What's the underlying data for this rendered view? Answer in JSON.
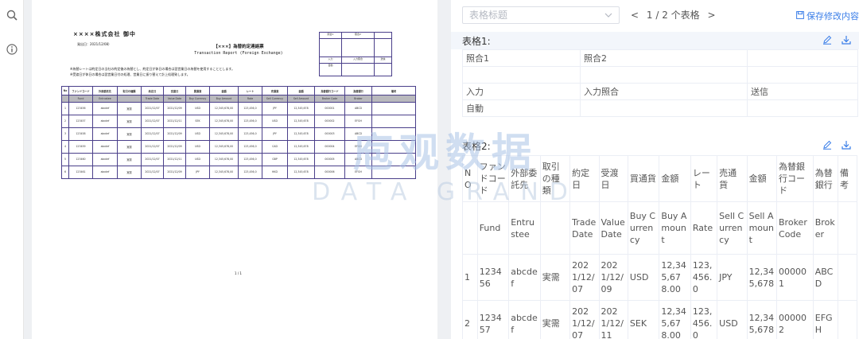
{
  "rail": {
    "icons": [
      "search-icon",
      "info-icon"
    ]
  },
  "document": {
    "recipient": "××××株式会社 御中",
    "issued": "発出日：2021/12/08）",
    "title": "【×××】為替約定連絡票",
    "subtitle": "Transaction Report (Foreign Exchange)",
    "notes": [
      "※為替レートは約定日の当社の約定後の為替とし、約定日が休日の場合は翌営業日の為替を使用することとします。",
      "※受渡日が休日の場合は翌営業日付の処理、営業日に振り替えて計上処理致します。"
    ],
    "stamp": {
      "row1": [
        "照合1",
        "照合2",
        ""
      ],
      "row2": [
        "",
        "",
        ""
      ],
      "row3": [
        "入力",
        "入力照合",
        "送信"
      ],
      "row4": [
        "自動",
        "",
        ""
      ]
    },
    "table": {
      "head1": [
        "No",
        "ファンドコード",
        "外部委託先",
        "取引の種類",
        "約定日",
        "受渡日",
        "買通貨",
        "金額",
        "レート",
        "売通貨",
        "金額",
        "為替銀行コード",
        "為替銀行",
        "備考"
      ],
      "head2": [
        "",
        "Fund",
        "Entrustee",
        "",
        "Trade Date",
        "Value Date",
        "Buy Currency",
        "Buy Amount",
        "Rate",
        "Sell Currency",
        "Sell Amount",
        "Broker Code",
        "Broker",
        ""
      ],
      "rows": [
        [
          "1",
          "123456",
          "abcdef",
          "実需",
          "2021/12/07",
          "2021/12/09",
          "USD",
          "12,345,678,00",
          "123,456,0",
          "JPY",
          "12,345,678",
          "000001",
          "ABCD",
          ""
        ],
        [
          "2",
          "123457",
          "abcdef",
          "実需",
          "2021/12/07",
          "2021/12/11",
          "SEK",
          "12,345,678,00",
          "123,456,0",
          "USD",
          "12,345,678",
          "000002",
          "EFGH",
          ""
        ],
        [
          "3",
          "123458",
          "abcdef",
          "実需",
          "2021/12/07",
          "2021/12/09",
          "USD",
          "12,345,678,00",
          "123,456,0",
          "JPY",
          "12,345,678",
          "000003",
          "ABCD",
          ""
        ],
        [
          "4",
          "123459",
          "abcdef",
          "実需",
          "2021/12/07",
          "2021/12/09",
          "USD",
          "12,345,678,00",
          "123,456,0",
          "CAD",
          "12,345,678",
          "000004",
          "EFGH",
          ""
        ],
        [
          "5",
          "123460",
          "abcdef",
          "実需",
          "2021/12/07",
          "2021/12/11",
          "USD",
          "12,345,678,00",
          "123,456,0",
          "GBP",
          "12,345,678",
          "000005",
          "ABCD",
          ""
        ],
        [
          "6",
          "123461",
          "abcdef",
          "実需",
          "2021/12/07",
          "2021/12/09",
          "JPY",
          "12,345,678,00",
          "123,456,0",
          "HKD",
          "12,345,678",
          "000006",
          "EFGH",
          ""
        ]
      ]
    },
    "page_indicator": "1 / 1"
  },
  "watermark": {
    "cn": "庖观数据",
    "en": "DATA GRAND"
  },
  "panel": {
    "select_placeholder": "表格标题",
    "pager": {
      "prev": "<",
      "current": "1 / 2 个表格",
      "next": ">"
    },
    "save_label": "保存修改内容",
    "table1": {
      "title": "表格1:",
      "rows": [
        [
          "照合1",
          "照合2",
          ""
        ],
        [
          "",
          "",
          ""
        ],
        [
          "入力",
          "入力照合",
          "送信"
        ],
        [
          "自動",
          "",
          ""
        ]
      ]
    },
    "table2": {
      "title": "表格2:",
      "header": [
        "N O",
        "ファンドコード",
        "外部委託先",
        "取引の種類",
        "約定日",
        "受渡日",
        "買通貨",
        "金額",
        "レート",
        "売通貨",
        "金額",
        "為替銀行コード",
        "為替銀行",
        "備考"
      ],
      "subheader": [
        "",
        "Fund",
        "Entrustee",
        "",
        "Trade Date",
        "Value Date",
        "Buy Currency",
        "Buy Amount",
        "Rate",
        "Sell Currency",
        "Sell Amount",
        "Broker Code",
        "Broker",
        ""
      ],
      "rows": [
        [
          "1",
          "123456",
          "abcdef",
          "実需",
          "2021/12/07",
          "2021/12/09",
          "USD",
          "12,345,678.00",
          "123,456.0",
          "JPY",
          "12,345,678",
          "000001",
          "ABCD",
          ""
        ],
        [
          "2",
          "123457",
          "abcdef",
          "実需",
          "2021/12/07",
          "2021/12/11",
          "SEK",
          "12,345,678.00",
          "123,456.0",
          "USD",
          "12,345,678",
          "000002",
          "EFGH",
          ""
        ]
      ]
    }
  }
}
